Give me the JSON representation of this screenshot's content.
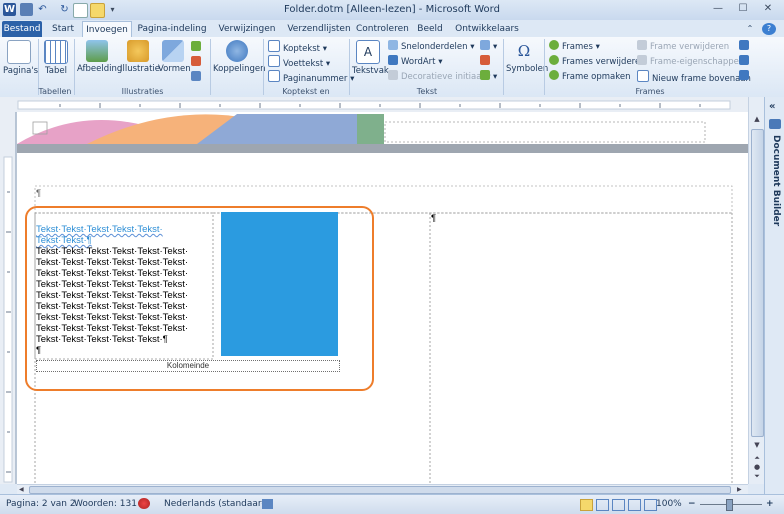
{
  "window": {
    "title": "Folder.dotm [Alleen-lezen] - Microsoft Word",
    "app_icon": "W",
    "minimize": "—",
    "maximize": "☐",
    "close": "✕"
  },
  "tabs": [
    "Bestand",
    "Start",
    "Invoegen",
    "Pagina-indeling",
    "Verwijzingen",
    "Verzendlijsten",
    "Controleren",
    "Beeld",
    "Ontwikkelaars"
  ],
  "ribbon": {
    "pages_label": "Pagina's",
    "table_label": "Tabel",
    "image_label": "Afbeelding",
    "illustration_label": "Illustratie",
    "shapes_label": "Vormen",
    "links_label": "Koppelingen",
    "header_label": "Koptekst",
    "footer_label": "Voettekst",
    "pagenumber_label": "Paginanummer",
    "textbox_label": "Tekstvak",
    "quickparts_label": "Snelonderdelen",
    "wordart_label": "WordArt",
    "dropcap_label": "Decoratieve initiaal",
    "symbols_label": "Symbolen",
    "symbol_glyph": "Ω",
    "frames_label": "Frames",
    "frames_remove_label": "Frames verwijderen",
    "frame_format_label": "Frame opmaken",
    "frame_remove_label": "Frame verwijderen",
    "frame_props_label": "Frame-eigenschappen",
    "new_frame_label": "Nieuw frame bovenaan",
    "groups": {
      "tables": "Tabellen",
      "illustrations": "Illustraties",
      "header_footer": "Koptekst en voettekst",
      "text": "Tekst",
      "frames": "Frames"
    }
  },
  "document": {
    "pilcrow": "¶",
    "heading_line1": "Tekst·Tekst·Tekst·Tekst·Tekst·",
    "heading_line2": "Tekst·Tekst·¶",
    "body_lines": [
      "Tekst·Tekst·Tekst·Tekst·Tekst·Tekst·",
      "Tekst·Tekst·Tekst·Tekst·Tekst·Tekst·",
      "Tekst·Tekst·Tekst·Tekst·Tekst·Tekst·",
      "Tekst·Tekst·Tekst·Tekst·Tekst·Tekst·",
      "Tekst·Tekst·Tekst·Tekst·Tekst·Tekst·",
      "Tekst·Tekst·Tekst·Tekst·Tekst·Tekst·",
      "Tekst·Tekst·Tekst·Tekst·Tekst·Tekst·",
      "Tekst·Tekst·Tekst·Tekst·Tekst·Tekst·",
      "Tekst·Tekst·Tekst·Tekst·Tekst·¶"
    ],
    "column_break": "Kolomeinde",
    "blue_block_color": "#2b9be0",
    "highlight_color": "#ee7d2b"
  },
  "side_pane": {
    "title": "Document Builder",
    "collapse": "«"
  },
  "status": {
    "page": "Pagina: 2 van 2",
    "words": "Woorden: 131",
    "language": "Nederlands (standaard)",
    "zoom": "100%",
    "zoom_out": "−",
    "zoom_in": "+"
  }
}
